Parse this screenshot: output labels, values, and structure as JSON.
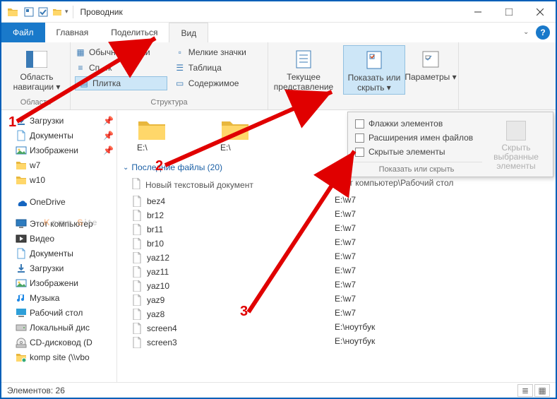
{
  "title": "Проводник",
  "menutabs": {
    "file": "Файл",
    "home": "Главная",
    "share": "Поделиться",
    "view": "Вид"
  },
  "ribbon": {
    "nav_area": "Область навигации",
    "layouts": {
      "large": "Обычные …чки",
      "medium": "Сп…к",
      "tile": "Плитка",
      "small": "Мелкие значки",
      "list": "Таблица",
      "content": "Содержимое"
    },
    "group_nav": "Области",
    "group_layout": "Структура",
    "current_view": "Текущее представление",
    "show_hide": "Показать или скрыть",
    "options": "Параметры"
  },
  "dropdown": {
    "checkboxes": "Флажки элементов",
    "extensions": "Расширения имен файлов",
    "hidden": "Скрытые элементы",
    "hide_selected": "Скрыть выбранные элементы",
    "group_label": "Показать или скрыть"
  },
  "nav": [
    {
      "icon": "download",
      "label": "Загрузки",
      "pin": true
    },
    {
      "icon": "doc",
      "label": "Документы",
      "pin": true
    },
    {
      "icon": "pic",
      "label": "Изображени",
      "pin": true
    },
    {
      "icon": "folder",
      "label": "w7"
    },
    {
      "icon": "folder",
      "label": "w10"
    },
    {
      "gap": true
    },
    {
      "icon": "onedrive",
      "label": "OneDrive"
    },
    {
      "gap": true
    },
    {
      "icon": "pc",
      "label": "Этот компьютер"
    },
    {
      "icon": "video",
      "label": "Видео"
    },
    {
      "icon": "doc",
      "label": "Документы"
    },
    {
      "icon": "download",
      "label": "Загрузки"
    },
    {
      "icon": "pic",
      "label": "Изображени"
    },
    {
      "icon": "music",
      "label": "Музыка"
    },
    {
      "icon": "desktop",
      "label": "Рабочий стол"
    },
    {
      "icon": "disk",
      "label": "Локальный дис"
    },
    {
      "icon": "cd",
      "label": "CD-дисковод (D"
    },
    {
      "icon": "netfolder",
      "label": "komp site (\\\\vbо"
    }
  ],
  "folders_row": [
    {
      "label": "E:\\"
    },
    {
      "label": "E:\\"
    }
  ],
  "section_header": "Последние файлы (20)",
  "list_header": "Новый текстовый документ",
  "list_header_b": "Этот компьютер\\Рабочий стол",
  "files": [
    {
      "name": "bez4",
      "path": "E:\\w7"
    },
    {
      "name": "br12",
      "path": "E:\\w7"
    },
    {
      "name": "br11",
      "path": "E:\\w7"
    },
    {
      "name": "br10",
      "path": "E:\\w7"
    },
    {
      "name": "yaz12",
      "path": "E:\\w7"
    },
    {
      "name": "yaz11",
      "path": "E:\\w7"
    },
    {
      "name": "yaz10",
      "path": "E:\\w7"
    },
    {
      "name": "yaz9",
      "path": "E:\\w7"
    },
    {
      "name": "yaz8",
      "path": "E:\\w7"
    },
    {
      "name": "screen4",
      "path": "E:\\ноутбук"
    },
    {
      "name": "screen3",
      "path": "E:\\ноутбук"
    }
  ],
  "status": {
    "count_label": "Элементов:",
    "count": "26"
  },
  "annot": {
    "n1": "1",
    "n2": "2",
    "n3": "3"
  },
  "watermark": {
    "a": "K",
    "b": "omp.",
    "c": "S",
    "d": "ite"
  }
}
